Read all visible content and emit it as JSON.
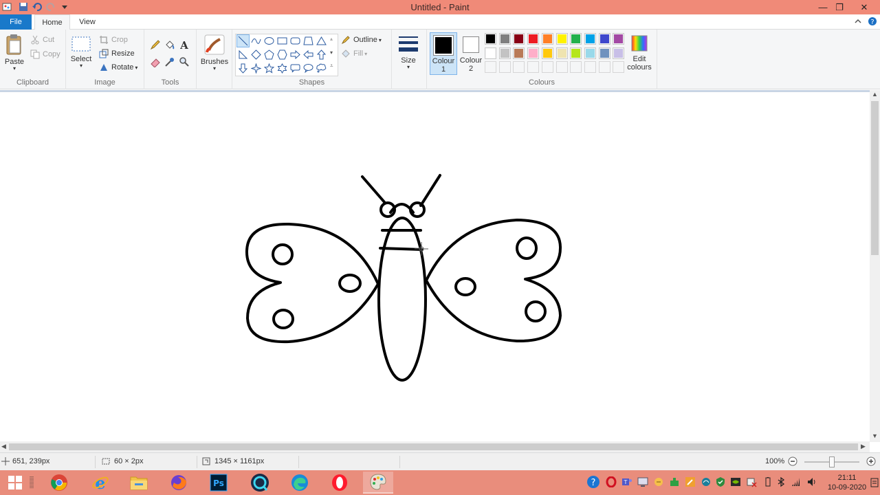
{
  "window": {
    "title": "Untitled - Paint",
    "minimize_glyph": "—",
    "restore_glyph": "❐",
    "close_glyph": "✕"
  },
  "tabs": {
    "file": "File",
    "home": "Home",
    "view": "View"
  },
  "clipboard": {
    "paste": "Paste",
    "cut": "Cut",
    "copy": "Copy",
    "label": "Clipboard"
  },
  "image": {
    "select": "Select",
    "crop": "Crop",
    "resize": "Resize",
    "rotate": "Rotate",
    "label": "Image"
  },
  "tools": {
    "label": "Tools"
  },
  "brushes": {
    "label": "Brushes"
  },
  "shapes": {
    "outline": "Outline",
    "fill": "Fill",
    "label": "Shapes"
  },
  "size": {
    "label": "Size"
  },
  "colours": {
    "colour1_line1": "Colour",
    "colour1_line2": "1",
    "colour2_line1": "Colour",
    "colour2_line2": "2",
    "edit_line1": "Edit",
    "edit_line2": "colours",
    "label": "Colours",
    "colour1_value": "#000000",
    "colour2_value": "#ffffff",
    "palette_row1": [
      "#000000",
      "#7f7f7f",
      "#880015",
      "#ed1c24",
      "#ff7f27",
      "#fff200",
      "#22b14c",
      "#00a2e8",
      "#3f48cc",
      "#a349a4"
    ],
    "palette_row2": [
      "#ffffff",
      "#c3c3c3",
      "#b97a57",
      "#ffaec9",
      "#ffc90e",
      "#efe4b0",
      "#b5e61d",
      "#99d9ea",
      "#7092be",
      "#c8bfe7"
    ]
  },
  "status": {
    "cursor_pos": "651, 239px",
    "selection_size": "60 × 2px",
    "image_size": "1345 × 1161px",
    "zoom": "100%"
  },
  "clock": {
    "time": "21:11",
    "date": "10-09-2020"
  }
}
